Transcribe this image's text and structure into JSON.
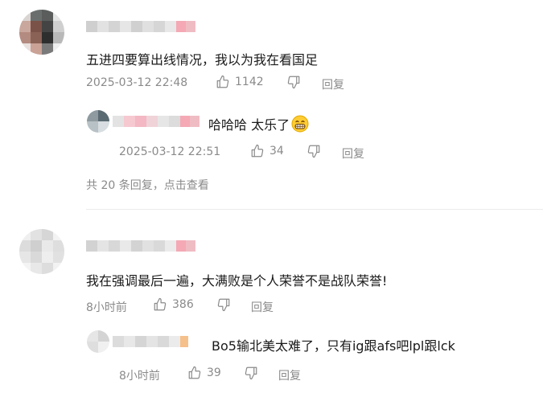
{
  "comments": [
    {
      "text": "五进四要算出线情况，我以为我在看国足",
      "time": "2025-03-12 22:48",
      "likes": "1142",
      "reply_label": "回复",
      "replies": [
        {
          "text": "哈哈哈 太乐了",
          "time": "2025-03-12 22:51",
          "likes": "34",
          "reply_label": "回复"
        }
      ],
      "more_replies": "共 20 条回复，点击查看"
    },
    {
      "text": "我在强调最后一遍，大满败是个人荣誉不是战队荣誉!",
      "time": "8小时前",
      "likes": "386",
      "reply_label": "回复",
      "replies": [
        {
          "text": "Bo5输北美太难了，只有ig跟afs吧lpl跟lck",
          "time": "8小时前",
          "likes": "39",
          "reply_label": "回复"
        }
      ]
    }
  ],
  "icons": {
    "like": "thumb-up-icon",
    "dislike": "thumb-down-icon",
    "emoji": "grinning-face-emoji"
  },
  "colors": {
    "meta_text": "#8a8a8a",
    "comment_text": "#1a1a1a",
    "blur_pink": "#f4a9b5",
    "emoji_yellow": "#ffcc33"
  }
}
